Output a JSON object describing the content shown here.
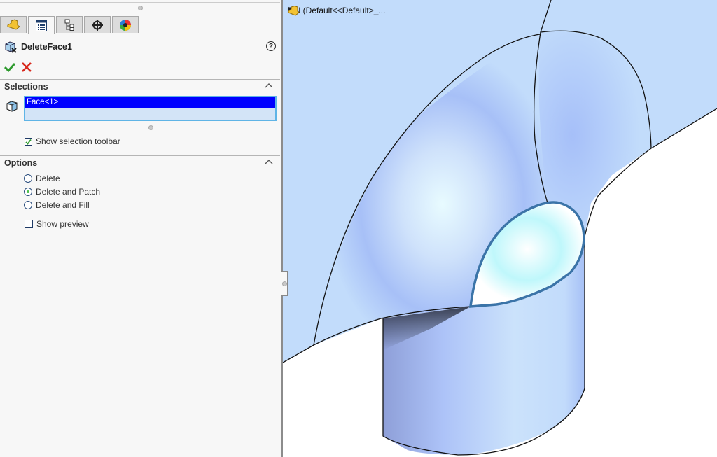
{
  "panel": {
    "tabs": [
      {
        "name": "featuremanager",
        "icon": "part-icon"
      },
      {
        "name": "propertymanager",
        "icon": "property-list-icon"
      },
      {
        "name": "configurationmanager",
        "icon": "configuration-tree-icon"
      },
      {
        "name": "dimxpertmanager",
        "icon": "crosshair-icon"
      },
      {
        "name": "displaymanager",
        "icon": "appearance-ball-icon"
      }
    ],
    "feature_title": "DeleteFace1",
    "help_label": "?",
    "ok_icon": "✔",
    "cancel_icon": "✕",
    "selections": {
      "header": "Selections",
      "items": [
        "Face<1>"
      ],
      "show_toolbar_label": "Show selection toolbar",
      "show_toolbar_checked": true
    },
    "options": {
      "header": "Options",
      "radios": [
        {
          "label": "Delete",
          "checked": false
        },
        {
          "label": "Delete and Patch",
          "checked": true
        },
        {
          "label": "Delete and Fill",
          "checked": false
        }
      ],
      "show_preview_label": "Show preview",
      "show_preview_checked": false
    }
  },
  "viewport": {
    "tree_label": "FIN  (Default<<Default>_...",
    "background_color": "#c2dcfb",
    "selected_face_color": "#3b74a8"
  }
}
